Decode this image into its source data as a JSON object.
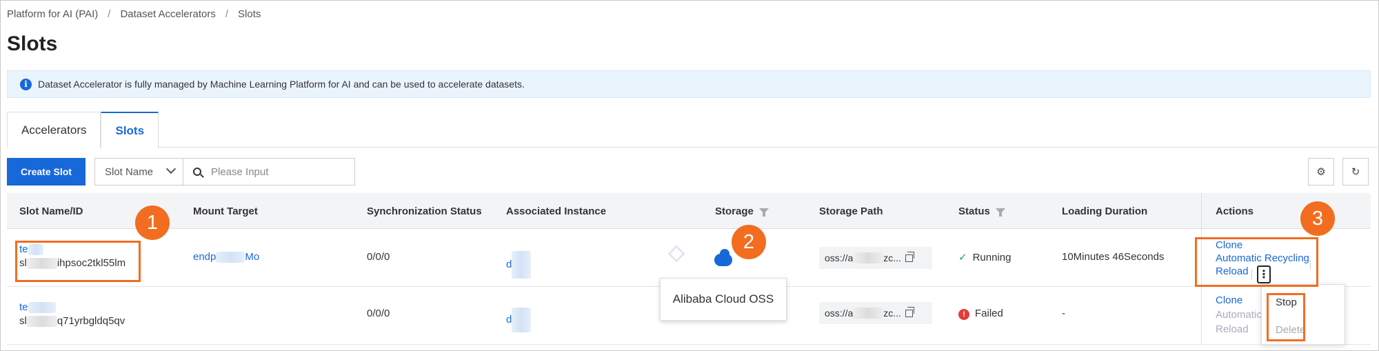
{
  "breadcrumb": [
    "Platform for AI (PAI)",
    "Dataset Accelerators",
    "Slots"
  ],
  "breadcrumb_separator": "/",
  "page_title": "Slots",
  "notice": {
    "icon": "info-icon",
    "text": "Dataset Accelerator is fully managed by Machine Learning Platform for AI and can be used to accelerate datasets."
  },
  "tabs": [
    {
      "label": "Accelerators",
      "active": false
    },
    {
      "label": "Slots",
      "active": true
    }
  ],
  "toolbar": {
    "create_label": "Create Slot",
    "filter_selected": "Slot Name",
    "search_placeholder": "Please Input",
    "settings_icon": "gear-icon",
    "refresh_icon": "refresh-icon"
  },
  "table": {
    "columns": [
      "Slot Name/ID",
      "Mount Target",
      "Synchronization Status",
      "Associated Instance",
      "Storage",
      "Storage Path",
      "Status",
      "Loading Duration",
      "Actions"
    ],
    "rows": [
      {
        "name": "te",
        "id": "sl",
        "id_suffix": "ihpsoc2tkl55lm",
        "mount_target_prefix": "endp",
        "mount_target_suffix": "Mo",
        "sync_status": "0/0/0",
        "associated_instance": "d",
        "storage_path_prefix": "oss://a",
        "storage_path_suffix": "zc...",
        "status": "Running",
        "loading_duration": "10Minutes 46Seconds",
        "actions": [
          "Clone",
          "Automatic Recycling",
          "Reload"
        ]
      },
      {
        "name": "te",
        "id": "sl",
        "id_suffix": "q71yrbgldq5qv",
        "mount_target_prefix": "",
        "mount_target_suffix": "",
        "sync_status": "0/0/0",
        "associated_instance": "d",
        "storage_path_prefix": "oss://a",
        "storage_path_suffix": "zc...",
        "status": "Failed",
        "loading_duration": "-",
        "actions": [
          "Clone",
          "Automatic",
          "Reload"
        ]
      }
    ]
  },
  "tooltip": "Alibaba Cloud OSS",
  "more_menu": [
    "Stop",
    "Delete"
  ],
  "more_button": "⋮",
  "callouts": [
    "1",
    "2",
    "3"
  ],
  "colors": {
    "accent": "#1768d9",
    "callout": "#f26d1f",
    "running": "#23a55a",
    "failed": "#e23c39"
  }
}
